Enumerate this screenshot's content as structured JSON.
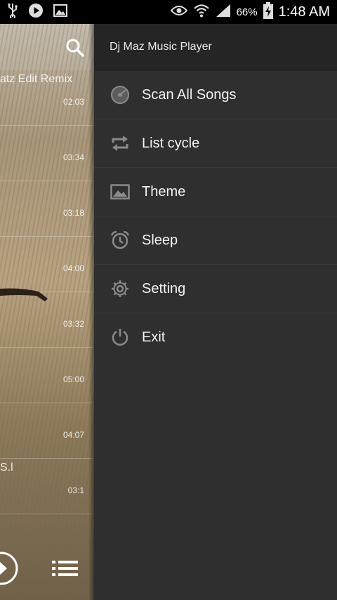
{
  "status_bar": {
    "battery_percent": "66%",
    "time": "1:48 AM",
    "icons": [
      "usb-icon",
      "play-icon",
      "image-icon",
      "eye-icon",
      "wifi-icon",
      "signal-icon",
      "battery-charging-icon"
    ]
  },
  "background_list": {
    "partial_title": "atz Edit Remix",
    "partial_subtitle": "S.l",
    "durations": [
      "02:03",
      "03:34",
      "03:18",
      "04:00",
      "03:32",
      "05:00",
      "04:07",
      "03:1"
    ]
  },
  "drawer": {
    "title": "Dj Maz Music Player",
    "items": [
      {
        "label": "Scan All Songs",
        "icon": "disc-icon"
      },
      {
        "label": "List cycle",
        "icon": "repeat-icon"
      },
      {
        "label": "Theme",
        "icon": "image-icon"
      },
      {
        "label": "Sleep",
        "icon": "alarm-clock-icon"
      },
      {
        "label": "Setting",
        "icon": "gear-icon"
      },
      {
        "label": "Exit",
        "icon": "power-icon"
      }
    ]
  },
  "colors": {
    "drawer_bg": "#2f2f2f",
    "drawer_header_bg": "#252525",
    "status_bar_bg": "#000000",
    "icon_gray": "#8a8a8a"
  }
}
